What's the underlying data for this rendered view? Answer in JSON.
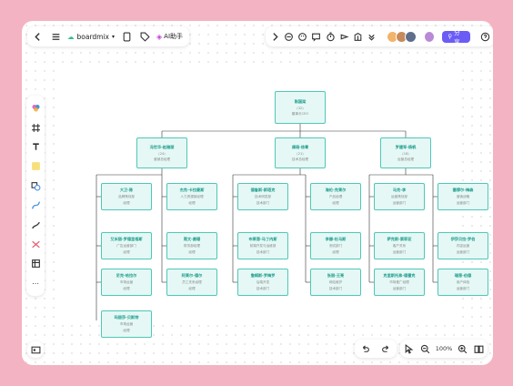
{
  "app": {
    "brand": "boardmix",
    "ai_label": "AI助手",
    "share_label": "分享"
  },
  "zoom": "100%",
  "org": {
    "root": {
      "name": "陈国梁",
      "lines": [
        "(32)",
        "董事长CEO"
      ]
    },
    "level1": [
      {
        "name": "冯世华-赵雅丽",
        "lines": [
          "(24)",
          "营销总经理"
        ]
      },
      {
        "name": "谭雨-徐青",
        "lines": [
          "(21)",
          "技术总经理"
        ]
      },
      {
        "name": "罗建军-杨帆",
        "lines": [
          "(18)",
          "运营总经理"
        ]
      }
    ],
    "groups": [
      {
        "left": [
          {
            "name": "大卫-陈",
            "lines": [
              "品牌策划部",
              "经理"
            ]
          },
          {
            "name": "艾米丽-罗德里格斯",
            "lines": [
              "广告运营部门",
              "经理"
            ]
          },
          {
            "name": "尼克-哈拉尔",
            "lines": [
              "市场运营",
              "经理"
            ]
          },
          {
            "name": "玛丽莎-贝斯特",
            "lines": [
              "市场运营",
              "经理"
            ]
          }
        ],
        "right": [
          {
            "name": "杰克-卡拉曼斯",
            "lines": [
              "人力资源部经理",
              "经理"
            ]
          },
          {
            "name": "周文-姜珊",
            "lines": [
              "财务部经理",
              "经理"
            ]
          },
          {
            "name": "阿莱尔-德尔",
            "lines": [
              "员工关系经理",
              "经理"
            ]
          }
        ]
      },
      {
        "left": [
          {
            "name": "德鲁斯-斯塔克",
            "lines": [
              "技术研发部",
              "技术部门"
            ]
          },
          {
            "name": "布莱恩-马丁内斯",
            "lines": [
              "前端开发与运维部",
              "技术部门"
            ]
          },
          {
            "name": "詹姆斯-罗梅罗",
            "lines": [
              "后端开发",
              "技术部门"
            ]
          }
        ],
        "right": [
          {
            "name": "海伦-克莱尔",
            "lines": [
              "产品经理",
              "经理"
            ]
          },
          {
            "name": "李娜-杜马斯",
            "lines": [
              "测试部门",
              "经理"
            ]
          },
          {
            "name": "张丽-王亮",
            "lines": [
              "网站维护",
              "技术部门"
            ]
          }
        ]
      },
      {
        "left": [
          {
            "name": "马克-李",
            "lines": [
              "运营策划部",
              "运营部门"
            ]
          },
          {
            "name": "萨克斯-索菲亚",
            "lines": [
              "客户关系",
              "运营部门"
            ]
          },
          {
            "name": "克里斯托弗-德雷克",
            "lines": [
              "市场推广经理",
              "运营部门"
            ]
          }
        ],
        "right": [
          {
            "name": "塞缪尔-梅森",
            "lines": [
              "营销战略",
              "运营部门"
            ]
          },
          {
            "name": "伊莎贝拉-罗伯",
            "lines": [
              "内容运营",
              "运营部门"
            ]
          },
          {
            "name": "瑞恩-伯德",
            "lines": [
              "用户体验",
              "运营部门"
            ]
          }
        ]
      }
    ]
  }
}
